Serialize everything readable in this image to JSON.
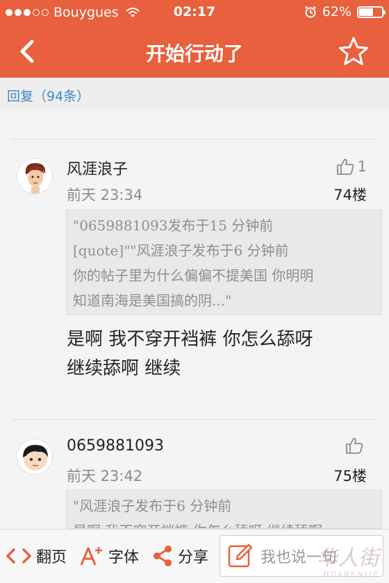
{
  "status_bar": {
    "carrier": "Bouygues",
    "time": "02:17",
    "battery": "62%",
    "battery_level": 0.62
  },
  "nav": {
    "title": "开始行动了",
    "back_icon": "chevron-left-icon",
    "favorite_icon": "star-icon"
  },
  "reply_bar": {
    "label": "回复（94条）"
  },
  "posts": [
    {
      "username": "风涯浪子",
      "time": "前天 23:34",
      "likes": "1",
      "floor": "74楼",
      "quote_lines": [
        "\"0659881093发布于15 分钟前",
        "[quote]\"\"风涯浪子发布于6 分钟前",
        "你的帖子里为什么偏偏不提美国 你明明",
        "知道南海是美国搞的阴...\""
      ],
      "content": "是啊 我不穿开裆裤 你怎么舔呀 继续舔啊 继续"
    },
    {
      "username": "0659881093",
      "time": "前天 23:42",
      "likes": "",
      "floor": "75楼",
      "quote_lines": [
        "\"风涯浪子发布于6 分钟前",
        "是啊 我不穿开裆裤 你怎么舔呀 继续舔啊"
      ]
    }
  ],
  "toolbar": {
    "page_label": "翻页",
    "font_label": "字体",
    "share_label": "分享",
    "compose_placeholder": "我也说一句"
  },
  "watermark": {
    "text": "华人街",
    "subtext": "HUARENJIE"
  },
  "colors": {
    "accent": "#e8603d",
    "link": "#3b87c7"
  }
}
